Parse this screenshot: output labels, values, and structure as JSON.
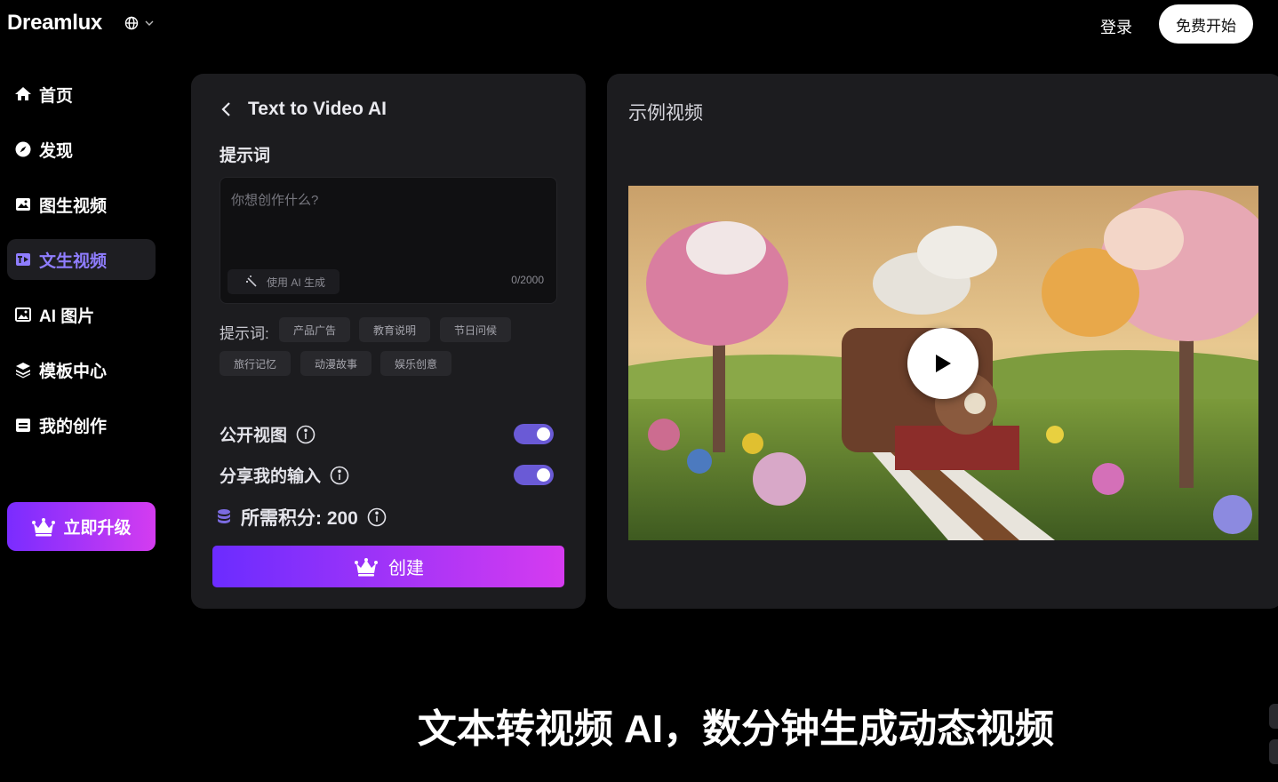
{
  "header": {
    "logo": "Dreamlux",
    "login": "登录",
    "start_free": "免费开始",
    "globe_icon": "globe-icon",
    "chevron_icon": "chevron-down-icon"
  },
  "sidebar": {
    "items": [
      {
        "label": "首页",
        "icon": "home-icon",
        "active": false
      },
      {
        "label": "发现",
        "icon": "compass-icon",
        "active": false
      },
      {
        "label": "图生视频",
        "icon": "image-video-icon",
        "active": false
      },
      {
        "label": "文生视频",
        "icon": "text-video-icon",
        "active": true
      },
      {
        "label": "AI 图片",
        "icon": "image-icon",
        "active": false
      },
      {
        "label": "模板中心",
        "icon": "layers-icon",
        "active": false
      },
      {
        "label": "我的创作",
        "icon": "folder-icon",
        "active": false
      }
    ],
    "upgrade": "立即升级"
  },
  "form": {
    "title": "Text to Video AI",
    "prompt_label": "提示词",
    "placeholder": "你想创作什么?",
    "ai_generate": "使用 AI 生成",
    "counter": "0/2000",
    "tags_label": "提示词:",
    "tags": [
      "产品广告",
      "教育说明",
      "节日问候",
      "旅行记忆",
      "动漫故事",
      "娱乐创意"
    ],
    "public_view": "公开视图",
    "share_input": "分享我的输入",
    "public_view_on": true,
    "share_input_on": true,
    "credits_label": "所需积分: 200",
    "create": "创建"
  },
  "example": {
    "title": "示例视频"
  },
  "headline": "文本转视频 AI，数分钟生成动态视频",
  "colors": {
    "accent": "#6a5ad6",
    "active_nav": "#8f7dff",
    "gradient_start": "#6b2cff",
    "gradient_end": "#d63bf0"
  }
}
